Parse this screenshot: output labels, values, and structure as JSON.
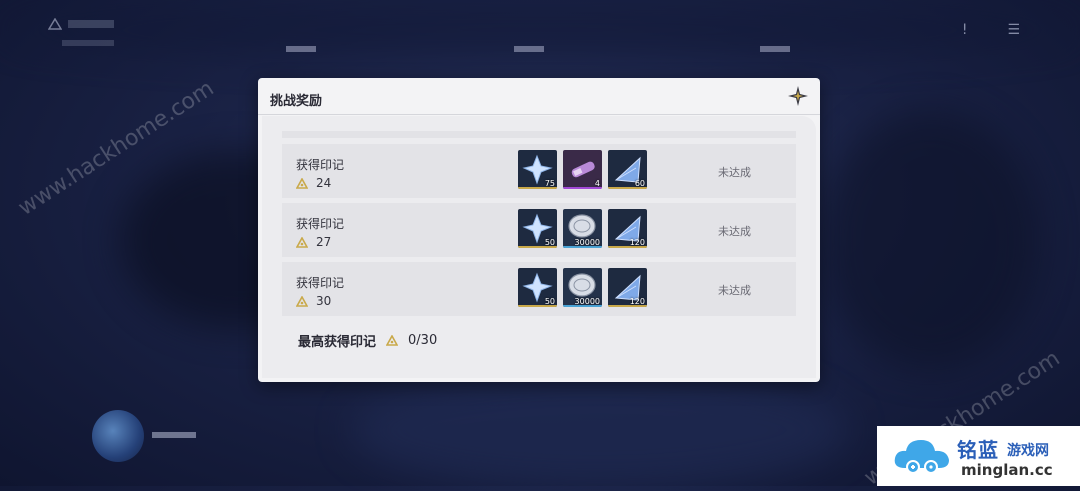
{
  "background": {
    "watermark_1": "www.hackhome.com",
    "watermark_2": "www.hackhome.com"
  },
  "dialog": {
    "title": "挑战奖励",
    "close_icon": "close-star-icon",
    "rows": [
      {
        "label": "获得印记",
        "count": "24",
        "status": "未达成",
        "items": [
          {
            "icon": "star-crystal-icon",
            "qty": "75",
            "rarity_color": "#c9a94a"
          },
          {
            "icon": "purple-capsule-icon",
            "qty": "4",
            "rarity_color": "#a24ad6"
          },
          {
            "icon": "blue-pyramid-icon",
            "qty": "60",
            "rarity_color": "#c9a94a"
          }
        ]
      },
      {
        "label": "获得印记",
        "count": "27",
        "status": "未达成",
        "items": [
          {
            "icon": "star-crystal-icon",
            "qty": "50",
            "rarity_color": "#c9a94a"
          },
          {
            "icon": "silver-coin-icon",
            "qty": "30000",
            "rarity_color": "#4aa4d6"
          },
          {
            "icon": "blue-pyramid-icon",
            "qty": "120",
            "rarity_color": "#c9a94a"
          }
        ]
      },
      {
        "label": "获得印记",
        "count": "30",
        "status": "未达成",
        "items": [
          {
            "icon": "star-crystal-icon",
            "qty": "50",
            "rarity_color": "#c9a94a"
          },
          {
            "icon": "silver-coin-icon",
            "qty": "30000",
            "rarity_color": "#4aa4d6"
          },
          {
            "icon": "blue-pyramid-icon",
            "qty": "120",
            "rarity_color": "#c9a94a"
          }
        ]
      }
    ],
    "summary": {
      "label": "最高获得印记",
      "value": "0/30"
    }
  },
  "logo": {
    "brand": "铭蓝",
    "sub": "游戏网",
    "domain": "minglan.cc"
  },
  "colors": {
    "accent_gold": "#c9a94a",
    "text_dark": "#2a2a35"
  }
}
